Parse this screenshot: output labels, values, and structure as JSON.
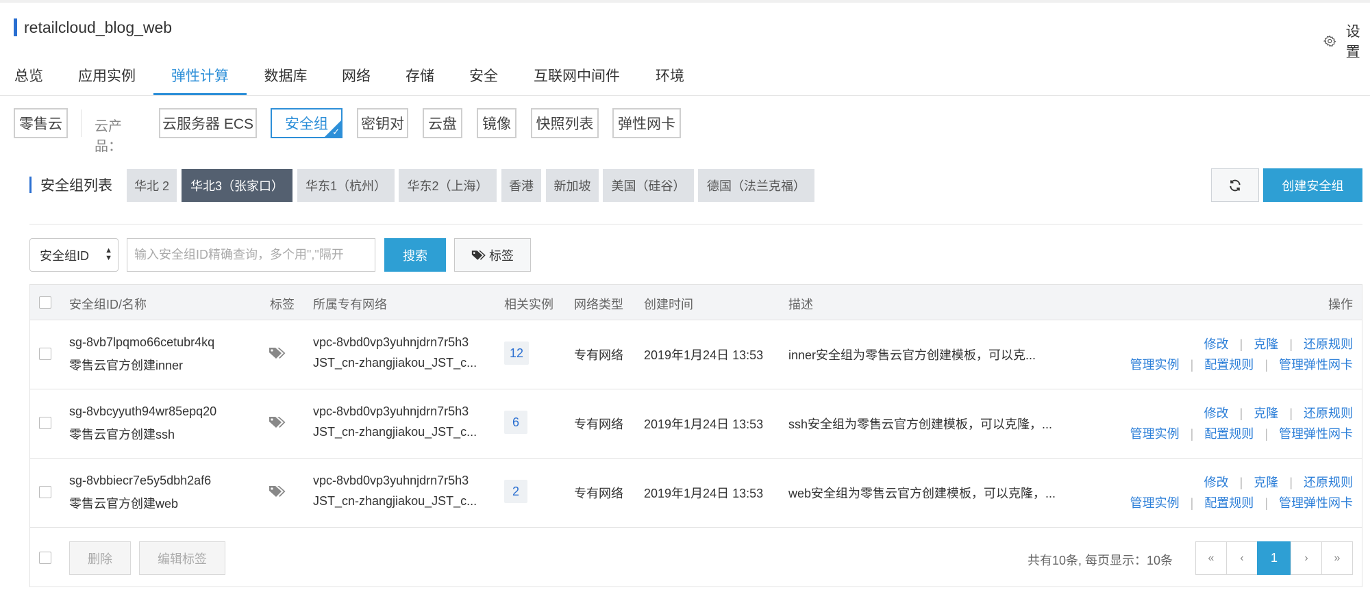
{
  "app": {
    "title": "retailcloud_blog_web",
    "settings_label": "设置"
  },
  "main_tabs": [
    {
      "label": "总览"
    },
    {
      "label": "应用实例"
    },
    {
      "label": "弹性计算"
    },
    {
      "label": "数据库"
    },
    {
      "label": "网络"
    },
    {
      "label": "存储"
    },
    {
      "label": "安全"
    },
    {
      "label": "互联网中间件"
    },
    {
      "label": "环境"
    }
  ],
  "active_main_tab": "弹性计算",
  "products": {
    "home": "零售云",
    "label": "云产品：",
    "items": [
      {
        "label": "云服务器 ECS"
      },
      {
        "label": "安全组"
      },
      {
        "label": "密钥对"
      },
      {
        "label": "云盘"
      },
      {
        "label": "镜像"
      },
      {
        "label": "快照列表"
      },
      {
        "label": "弹性网卡"
      }
    ],
    "active": "安全组"
  },
  "regions": {
    "title": "安全组列表",
    "items": [
      {
        "label": "华北 2"
      },
      {
        "label": "华北3（张家口）"
      },
      {
        "label": "华东1（杭州）"
      },
      {
        "label": "华东2（上海）"
      },
      {
        "label": "香港"
      },
      {
        "label": "新加坡"
      },
      {
        "label": "美国（硅谷）"
      },
      {
        "label": "德国（法兰克福）"
      }
    ],
    "active": "华北3（张家口）"
  },
  "actions": {
    "create_label": "创建安全组"
  },
  "search": {
    "field_selected": "安全组ID",
    "placeholder": "输入安全组ID精确查询，多个用\",\"隔开",
    "search_label": "搜索",
    "tag_label": "标签"
  },
  "table": {
    "headers": {
      "id_name": "安全组ID/名称",
      "tag": "标签",
      "vpc": "所属专有网络",
      "instances": "相关实例",
      "net_type": "网络类型",
      "created": "创建时间",
      "desc": "描述",
      "ops": "操作"
    },
    "rows": [
      {
        "id": "sg-8vb7lpqmo66cetubr4kq",
        "name": "零售云官方创建inner",
        "vpc_id": "vpc-8vbd0vp3yuhnjdrn7r5h3",
        "vpc_name": "JST_cn-zhangjiakou_JST_c...",
        "instances": "12",
        "net_type": "专有网络",
        "created": "2019年1月24日 13:53",
        "desc": "inner安全组为零售云官方创建模板，可以克..."
      },
      {
        "id": "sg-8vbcyyuth94wr85epq20",
        "name": "零售云官方创建ssh",
        "vpc_id": "vpc-8vbd0vp3yuhnjdrn7r5h3",
        "vpc_name": "JST_cn-zhangjiakou_JST_c...",
        "instances": "6",
        "net_type": "专有网络",
        "created": "2019年1月24日 13:53",
        "desc": "ssh安全组为零售云官方创建模板，可以克隆，..."
      },
      {
        "id": "sg-8vbbiecr7e5y5dbh2af6",
        "name": "零售云官方创建web",
        "vpc_id": "vpc-8vbd0vp3yuhnjdrn7r5h3",
        "vpc_name": "JST_cn-zhangjiakou_JST_c...",
        "instances": "2",
        "net_type": "专有网络",
        "created": "2019年1月24日 13:53",
        "desc": "web安全组为零售云官方创建模板，可以克隆，..."
      }
    ],
    "row_ops": {
      "modify": "修改",
      "clone": "克隆",
      "restore": "还原规则",
      "manage_instances": "管理实例",
      "config_rules": "配置规则",
      "manage_eni": "管理弹性网卡"
    },
    "op_separator": "|"
  },
  "footer": {
    "delete_label": "删除",
    "edit_tags_label": "编辑标签",
    "pager_info": "共有10条, 每页显示：10条",
    "first": "«",
    "prev": "‹",
    "page": "1",
    "next": "›",
    "last": "»"
  }
}
